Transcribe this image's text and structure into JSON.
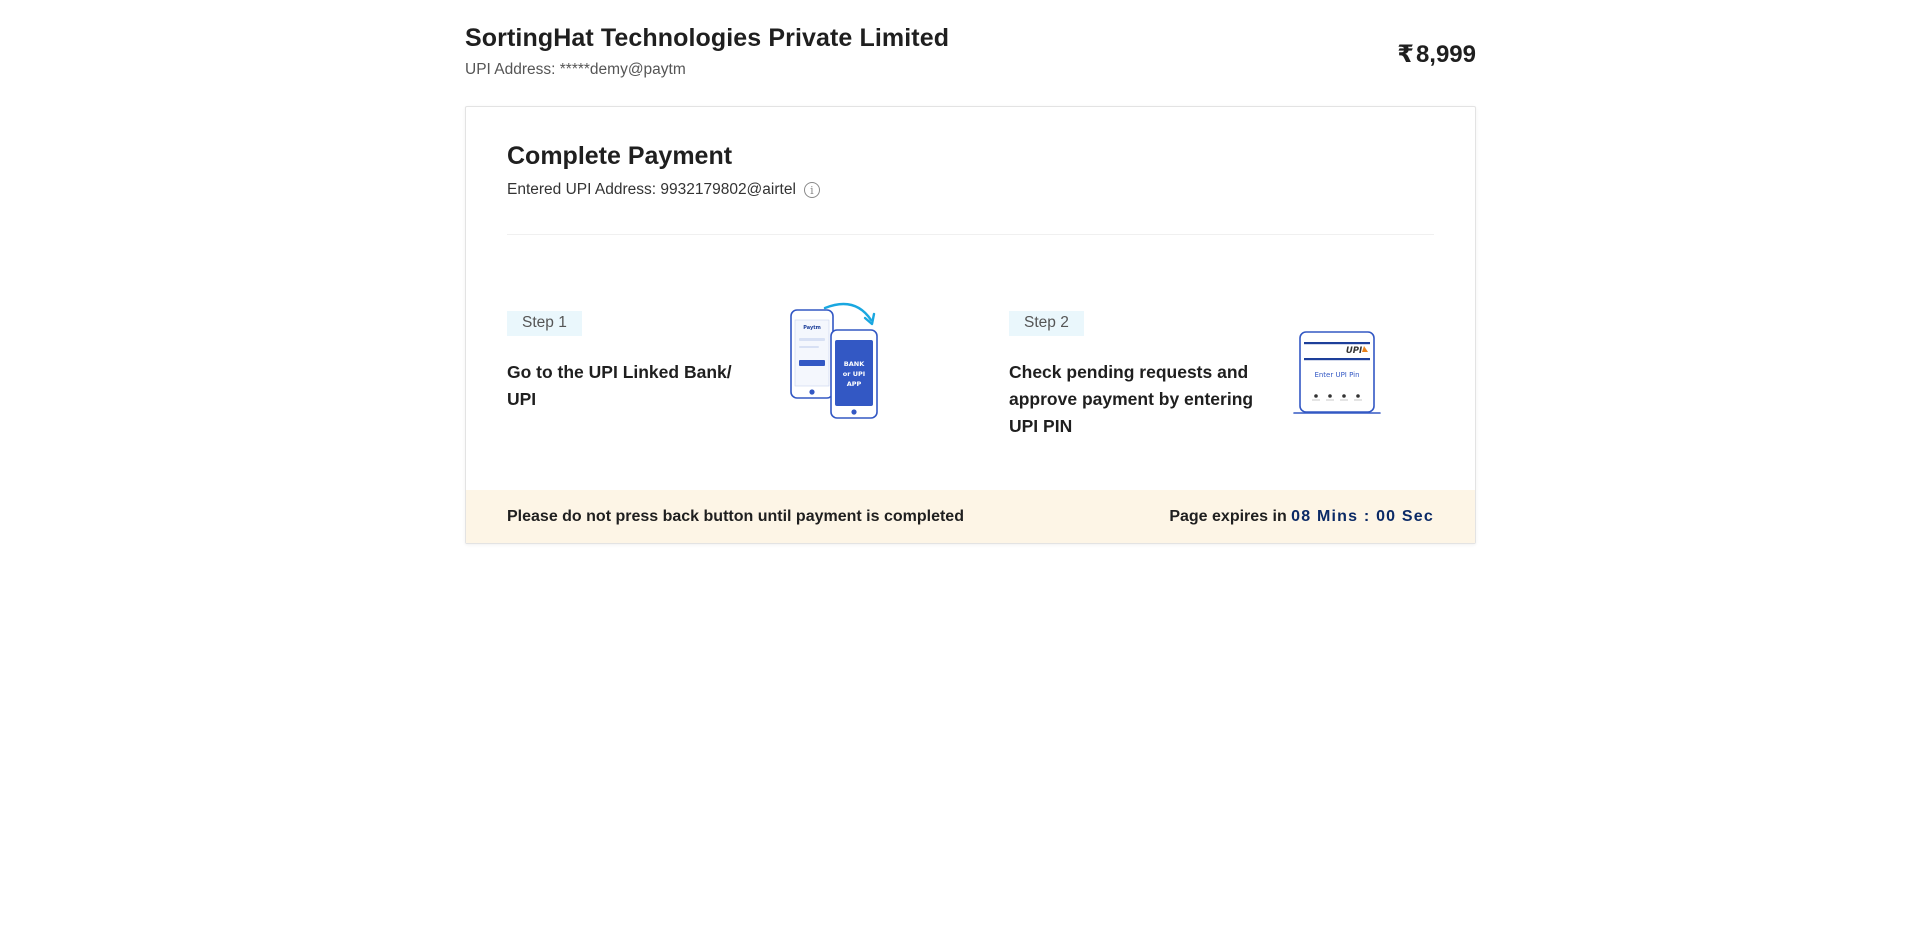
{
  "merchant": {
    "name": "SortingHat Technologies Private Limited",
    "upi_address": "UPI Address: *****demy@paytm"
  },
  "amount": {
    "currency_symbol": "₹",
    "value": "8,999"
  },
  "payment": {
    "title": "Complete Payment",
    "entered_upi": "Entered UPI Address: 9932179802@airtel",
    "info_icon": "info-icon",
    "info_glyph": "i"
  },
  "steps": [
    {
      "badge": "Step 1",
      "text": "Go to the UPI Linked Bank/ UPI",
      "illustration": {
        "icon": "phones-transfer-icon",
        "phone_label_lines": [
          "BANK",
          "or UPI",
          "APP"
        ],
        "small_logo": "Paytm"
      }
    },
    {
      "badge": "Step 2",
      "text": "Check pending requests and approve payment by entering UPI PIN",
      "illustration": {
        "icon": "upi-pin-screen-icon",
        "upi_logo": "UPI",
        "screen_label": "Enter UPI Pin"
      }
    }
  ],
  "footer": {
    "warning": "Please do not press back button until payment is completed",
    "expiry_prefix": "Page expires in ",
    "timer": "08 Mins : 00 Sec"
  },
  "colors": {
    "footer_bg": "#fdf5e6",
    "step_badge_bg": "#eaf7fc",
    "timer": "#0b2a66",
    "illustration_blue": "#3358c4",
    "arrow_cyan": "#19a7e0"
  }
}
